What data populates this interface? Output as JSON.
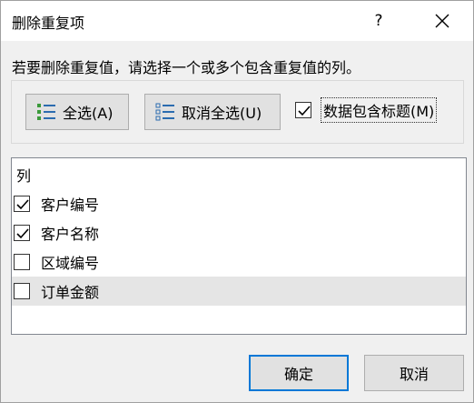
{
  "window": {
    "title": "删除重复项",
    "help_label": "?"
  },
  "instruction": "若要删除重复值，请选择一个或多个包含重复值的列。",
  "buttons": {
    "select_all": "全选(A)",
    "unselect_all": "取消全选(U)"
  },
  "header_option": {
    "label": "数据包含标题(M)",
    "checked": true
  },
  "columns_list": {
    "header": "列",
    "items": [
      {
        "label": "客户编号",
        "checked": true
      },
      {
        "label": "客户名称",
        "checked": true
      },
      {
        "label": "区域编号",
        "checked": false
      },
      {
        "label": "订单金额",
        "checked": false
      }
    ]
  },
  "footer": {
    "ok": "确定",
    "cancel": "取消"
  },
  "colors": {
    "accent": "#0078d7",
    "icon_green": "#3a9a3a",
    "icon_blue": "#2b6cb0"
  }
}
